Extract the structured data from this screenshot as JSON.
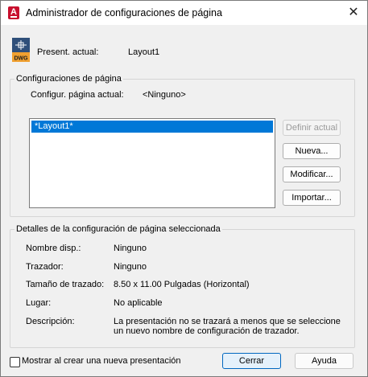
{
  "window": {
    "title": "Administrador de configuraciones de página"
  },
  "current_presentation": {
    "label": "Present. actual:",
    "value": "Layout1"
  },
  "page_setups": {
    "group_title": "Configuraciones de página",
    "current_label": "Configur. página actual:",
    "current_value": "<Ninguno>",
    "list_items": [
      "*Layout1*"
    ],
    "buttons": {
      "set_current": "Definir actual",
      "new": "Nueva...",
      "modify": "Modificar...",
      "import": "Importar..."
    }
  },
  "details": {
    "group_title": "Detalles de la configuración de página seleccionada",
    "device_name_label": "Nombre disp.:",
    "device_name_value": "Ninguno",
    "plotter_label": "Trazador:",
    "plotter_value": "Ninguno",
    "plot_size_label": "Tamaño de trazado:",
    "plot_size_value": "8.50 x 11.00 Pulgadas (Horizontal)",
    "where_label": "Lugar:",
    "where_value": "No aplicable",
    "description_label": "Descripción:",
    "description_line1": "La presentación no se trazará a menos que se seleccione",
    "description_line2": "un nuevo nombre de configuración de trazador."
  },
  "footer": {
    "checkbox_label": "Mostrar al crear una nueva presentación",
    "checkbox_checked": false,
    "close_button": "Cerrar",
    "help_button": "Ayuda"
  },
  "colors": {
    "accent": "#0078d7",
    "app_icon": "#c8102e"
  }
}
